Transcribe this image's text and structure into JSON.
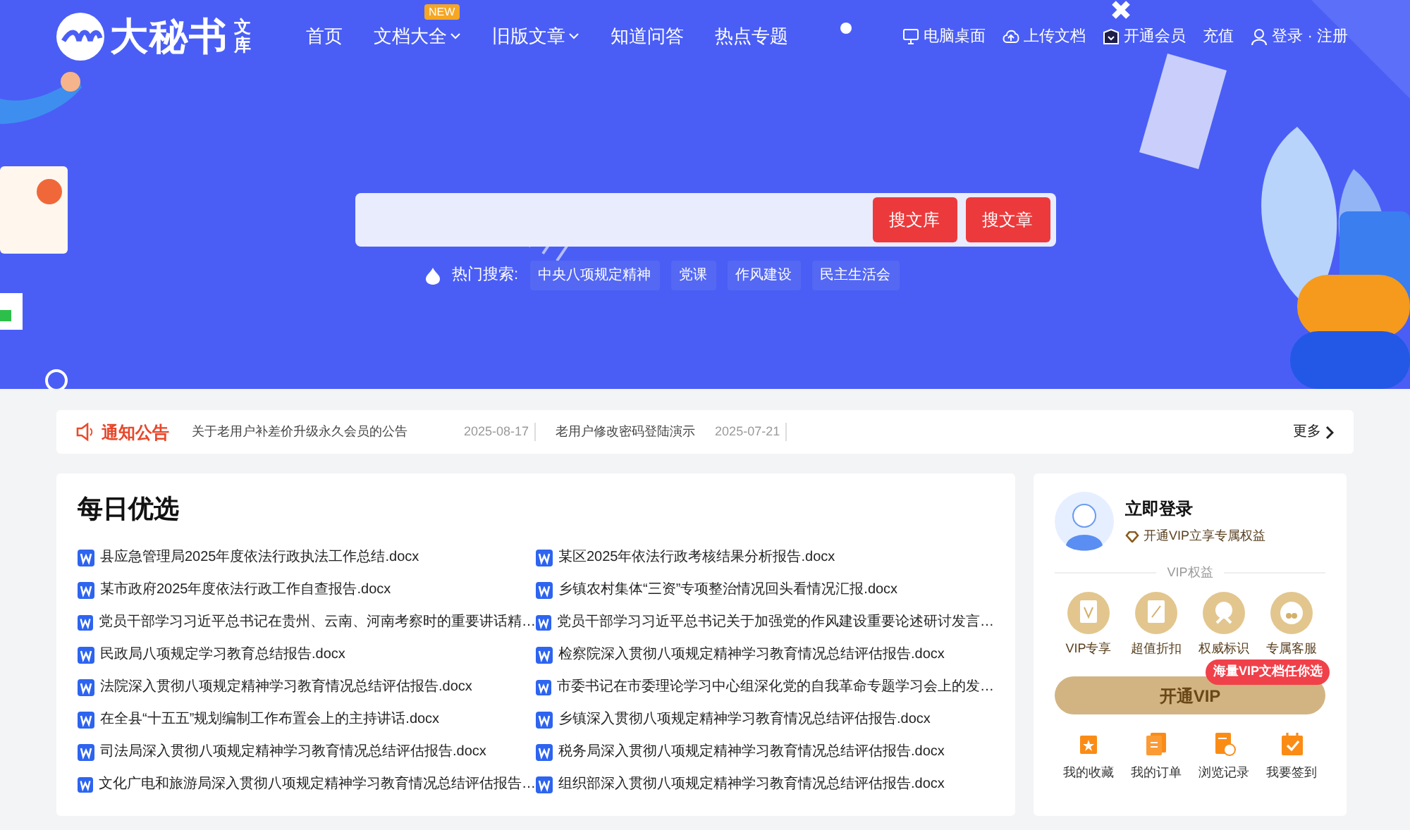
{
  "logo": {
    "name": "大秘书",
    "suffix": "文库"
  },
  "nav": [
    {
      "label": "首页",
      "dropdown": false
    },
    {
      "label": "文档大全",
      "dropdown": true,
      "badge": "NEW"
    },
    {
      "label": "旧版文章",
      "dropdown": true
    },
    {
      "label": "知道问答",
      "dropdown": false
    },
    {
      "label": "热点专题",
      "dropdown": false
    }
  ],
  "top_links": [
    {
      "kind": "desktop",
      "label": "电脑桌面"
    },
    {
      "kind": "upload",
      "label": "上传文档"
    },
    {
      "kind": "vip",
      "label": "开通会员"
    },
    {
      "kind": "plain",
      "label": "充值"
    },
    {
      "kind": "user",
      "label": "登录 · 注册"
    }
  ],
  "search": {
    "buttons": [
      "搜文库",
      "搜文章"
    ],
    "hot_label": "热门搜索:",
    "hot_tags": [
      "中央八项规定精神",
      "党课",
      "作风建设",
      "民主生活会"
    ]
  },
  "notice": {
    "title": "通知公告",
    "items": [
      {
        "text": "关于老用户补差价升级永久会员的公告",
        "date": "2025-08-17"
      },
      {
        "text": "老用户修改密码登陆演示",
        "date": "2025-07-21"
      }
    ],
    "more": "更多"
  },
  "daily": {
    "title": "每日优选",
    "items": [
      "县应急管理局2025年度依法行政执法工作总结.docx",
      "某区2025年依法行政考核结果分析报告.docx",
      "某市政府2025年度依法行政工作自查报告.docx",
      "乡镇农村集体“三资”专项整治情况回头看情况汇报.docx",
      "党员干部学习习近平总书记在贵州、云南、河南考察时的重要讲话精…",
      "党员干部学习习近平总书记关于加强党的作风建设重要论述研讨发言…",
      "民政局八项规定学习教育总结报告.docx",
      "检察院深入贯彻八项规定精神学习教育情况总结评估报告.docx",
      "法院深入贯彻八项规定精神学习教育情况总结评估报告.docx",
      "市委书记在市委理论学习中心组深化党的自我革命专题学习会上的发…",
      "在全县“十五五”规划编制工作布置会上的主持讲话.docx",
      "乡镇深入贯彻八项规定精神学习教育情况总结评估报告.docx",
      "司法局深入贯彻八项规定精神学习教育情况总结评估报告.docx",
      "税务局深入贯彻八项规定精神学习教育情况总结评估报告.docx",
      "文化广电和旅游局深入贯彻八项规定精神学习教育情况总结评估报告…",
      "组织部深入贯彻八项规定精神学习教育情况总结评估报告.docx"
    ]
  },
  "user_panel": {
    "login": "立即登录",
    "vip_hint": "开通VIP立享专属权益",
    "benefits_title": "VIP权益",
    "benefits": [
      "VIP专享",
      "超值折扣",
      "权威标识",
      "专属客服"
    ],
    "vip_button": "开通VIP",
    "vip_badge": "海量VIP文档任你选",
    "shortcuts": [
      {
        "kind": "favorite",
        "label": "我的收藏"
      },
      {
        "kind": "order",
        "label": "我的订单"
      },
      {
        "kind": "history",
        "label": "浏览记录"
      },
      {
        "kind": "checkin",
        "label": "我要签到"
      }
    ]
  }
}
